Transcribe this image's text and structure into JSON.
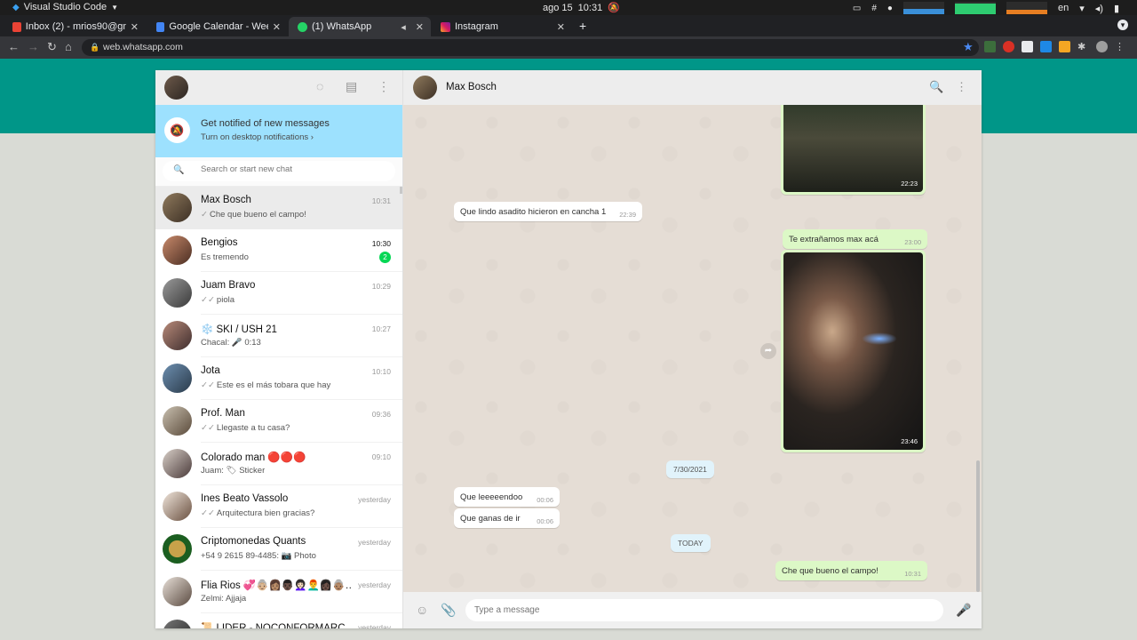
{
  "os_bar": {
    "app_name": "Visual Studio Code",
    "date": "ago 15",
    "time": "10:31",
    "lang": "en"
  },
  "browser": {
    "tabs": [
      {
        "label": "Inbox (2) - mrios90@gmai",
        "icon": "gmail-icon",
        "active": false
      },
      {
        "label": "Google Calendar - Week o",
        "icon": "calendar-icon",
        "active": false
      },
      {
        "label": "(1) WhatsApp",
        "icon": "whatsapp-icon",
        "active": true
      },
      {
        "label": "Instagram",
        "icon": "instagram-icon",
        "active": false
      }
    ],
    "url": "web.whatsapp.com"
  },
  "sidebar": {
    "notification": {
      "title": "Get notified of new messages",
      "subtitle": "Turn on desktop notifications ›"
    },
    "search_placeholder": "Search or start new chat",
    "chats": [
      {
        "name": "Max Bosch",
        "time": "10:31",
        "msg": "Che que bueno el campo!",
        "ticks": "✓",
        "active": true
      },
      {
        "name": "Bengios",
        "time": "10:30",
        "msg": "Es tremendo",
        "ticks": "",
        "unread": "2"
      },
      {
        "name": "Juam Bravo",
        "time": "10:29",
        "msg": "piola",
        "ticks": "✓✓"
      },
      {
        "name": "❄️ SKI / USH 21",
        "time": "10:27",
        "msg": "Chacal: 🎤 0:13",
        "ticks": ""
      },
      {
        "name": "Jota",
        "time": "10:10",
        "msg": "Este es el más tobara que hay",
        "ticks": "✓✓"
      },
      {
        "name": "Prof. Man",
        "time": "09:36",
        "msg": "Llegaste a tu casa?",
        "ticks": "✓✓"
      },
      {
        "name": "Colorado man 🔴🔴🔴",
        "time": "09:10",
        "msg": "Juam: 🏷 Sticker",
        "ticks": ""
      },
      {
        "name": "Ines Beato Vassolo",
        "time": "yesterday",
        "msg": "Arquitectura bien gracias?",
        "ticks": "✓✓"
      },
      {
        "name": "Criptomonedas Quants",
        "time": "yesterday",
        "msg": "+54 9 2615 89-4485: 📷 Photo",
        "ticks": ""
      },
      {
        "name": "Flia Rios 💞👵🏼👩🏽👨🏿👩🏻‍🦱👨‍🦰👩🏿👵🏽…",
        "time": "yesterday",
        "msg": "Zelmi: Ajjaja",
        "ticks": ""
      },
      {
        "name": "📜 LIDER - NOCONFORMARC",
        "time": "yesterday",
        "msg": "",
        "ticks": ""
      }
    ]
  },
  "conversation": {
    "contact_name": "Max Bosch",
    "messages": {
      "photo1_time": "22:23",
      "in1": {
        "text": "Que lindo asadito hicieron en cancha 1",
        "time": "22:39"
      },
      "out1": {
        "text": "Te extrañamos max acá",
        "time": "23:00"
      },
      "photo2_time": "23:46",
      "date_chip": "7/30/2021",
      "in2": {
        "text": "Que leeeeendoo",
        "time": "00:06"
      },
      "in3": {
        "text": "Que ganas de ir",
        "time": "00:06"
      },
      "today_chip": "TODAY",
      "out2": {
        "text": "Che que bueno el campo!",
        "time": "10:31"
      }
    },
    "composer_placeholder": "Type a message"
  },
  "colors": {
    "accent_teal": "#009688",
    "outgoing_bubble": "#dcf8c6",
    "unread_badge": "#06d755",
    "notification_banner": "#9de1fe"
  }
}
